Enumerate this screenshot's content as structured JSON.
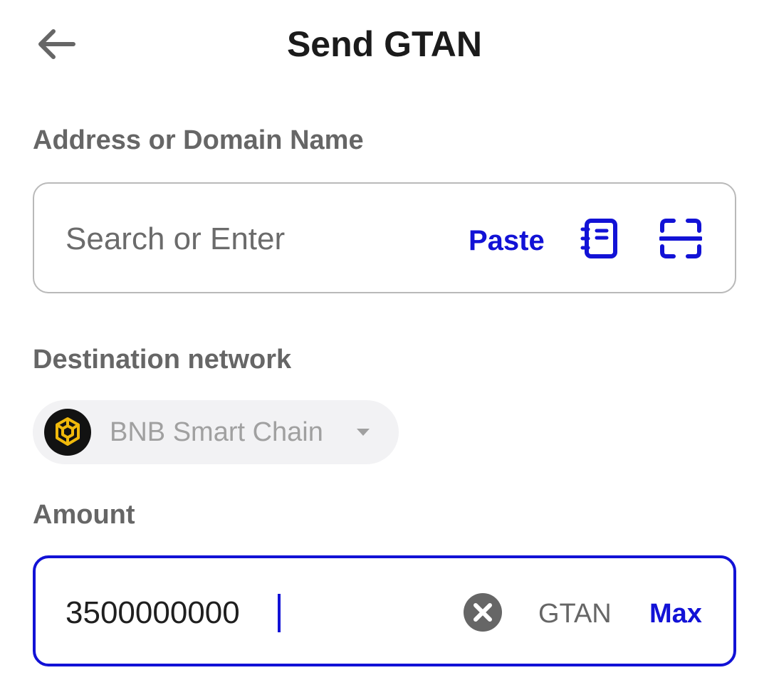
{
  "header": {
    "title": "Send GTAN",
    "back_icon": "arrow-left-icon"
  },
  "address": {
    "label": "Address or Domain Name",
    "placeholder": "Search or Enter",
    "value": "",
    "paste_label": "Paste",
    "address_book_icon": "address-book-icon",
    "scan_icon": "qr-scan-icon"
  },
  "network": {
    "label": "Destination network",
    "selected": "BNB Smart Chain",
    "logo_icon": "bnb-logo-icon",
    "dropdown_icon": "chevron-down-icon"
  },
  "amount": {
    "label": "Amount",
    "value": "3500000000",
    "clear_icon": "clear-icon",
    "unit": "GTAN",
    "max_label": "Max"
  },
  "colors": {
    "accent": "#1212d6",
    "label": "#666666",
    "bnb_yellow": "#f0b90b"
  }
}
